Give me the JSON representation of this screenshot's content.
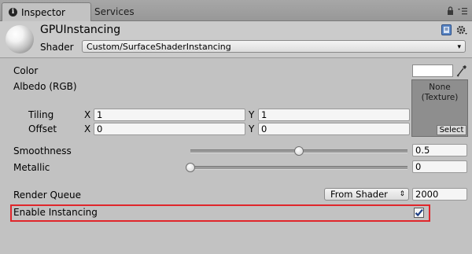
{
  "tabs": [
    {
      "label": "Inspector",
      "active": true
    },
    {
      "label": "Services",
      "active": false
    }
  ],
  "toolbar_icons": [
    "lock-icon",
    "menu-icon"
  ],
  "header": {
    "material_name": "GPUInstancing",
    "shader_label": "Shader",
    "shader_value": "Custom/SurfaceShaderInstancing",
    "icons": [
      "book-icon",
      "gear-icon"
    ]
  },
  "color": {
    "label": "Color",
    "value": "#ffffff"
  },
  "albedo": {
    "label": "Albedo (RGB)",
    "texture_line1": "None",
    "texture_line2": "(Texture)",
    "select_label": "Select",
    "tiling": {
      "label": "Tiling",
      "x_label": "X",
      "x_value": "1",
      "y_label": "Y",
      "y_value": "1"
    },
    "offset": {
      "label": "Offset",
      "x_label": "X",
      "x_value": "0",
      "y_label": "Y",
      "y_value": "0"
    }
  },
  "smoothness": {
    "label": "Smoothness",
    "value": "0.5",
    "fraction": 0.5
  },
  "metallic": {
    "label": "Metallic",
    "value": "0",
    "fraction": 0.0
  },
  "render_queue": {
    "label": "Render Queue",
    "dropdown_value": "From Shader",
    "value": "2000"
  },
  "instancing": {
    "label": "Enable Instancing",
    "checked": true
  },
  "colors": {
    "highlight": "#e0262b",
    "panel": "#c2c2c2",
    "check": "#1e3f84"
  }
}
